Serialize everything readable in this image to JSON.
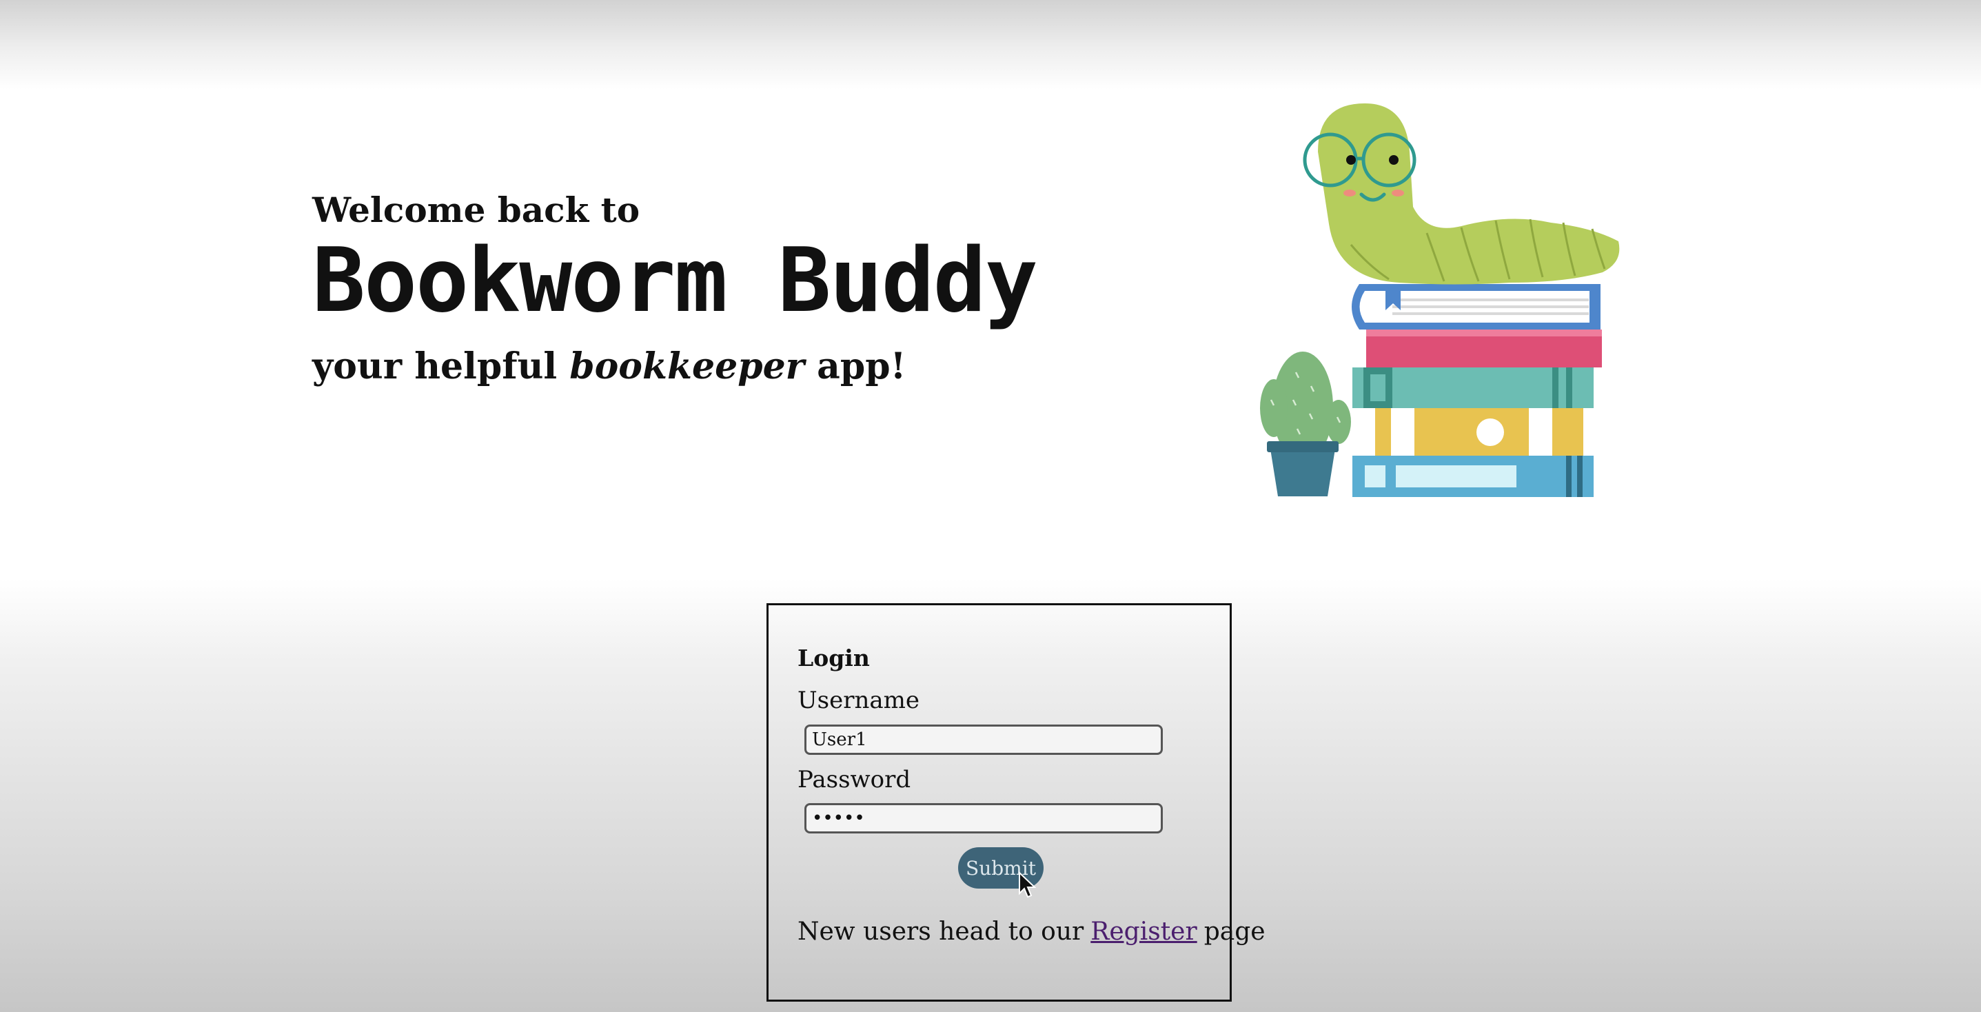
{
  "hero": {
    "welcome": "Welcome back to",
    "brand": "Bookworm Buddy",
    "tagline_prefix": "your helpful ",
    "tagline_emphasis": "bookkeeper",
    "tagline_suffix": " app!"
  },
  "illustration": {
    "icon": "bookworm-on-books-illustration"
  },
  "login": {
    "title": "Login",
    "username_label": "Username",
    "username_value": "User1",
    "password_label": "Password",
    "password_value": "•••••",
    "submit_label": "Submit",
    "register_prefix": "New users head to our",
    "register_link": "Register",
    "register_suffix": "page"
  },
  "colors": {
    "submit_button": "#3e6478",
    "link": "#4b1f6e",
    "worm": "#b5cd5c",
    "glasses": "#2f9a8f"
  }
}
